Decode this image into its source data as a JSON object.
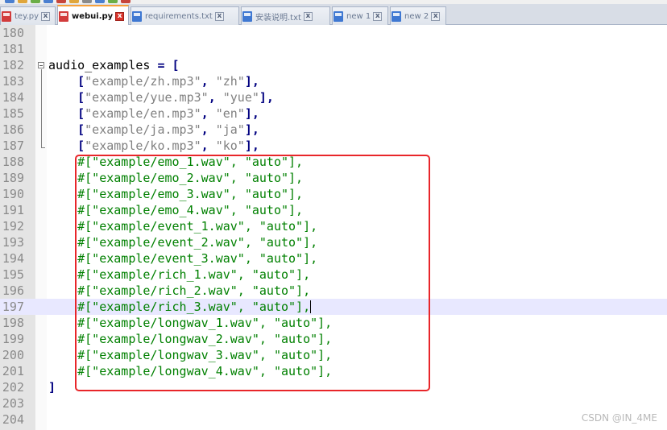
{
  "tabs": [
    {
      "label": "tey.py",
      "state": "unsaved",
      "active": false
    },
    {
      "label": "webui.py",
      "state": "unsaved",
      "active": true
    },
    {
      "label": "requirements.txt",
      "state": "saved",
      "active": false
    },
    {
      "label": "安装说明.txt",
      "state": "saved",
      "active": false
    },
    {
      "label": "new 1",
      "state": "saved",
      "active": false
    },
    {
      "label": "new 2",
      "state": "saved",
      "active": false
    }
  ],
  "tab_close_glyph": "x",
  "editor": {
    "current_line": 197,
    "lines": [
      {
        "num": "180",
        "parts": []
      },
      {
        "num": "181",
        "parts": []
      },
      {
        "num": "182",
        "parts": [
          {
            "t": "plain",
            "v": "audio_examples "
          },
          {
            "t": "kw",
            "v": "= ["
          }
        ]
      },
      {
        "num": "183",
        "parts": [
          {
            "t": "plain",
            "v": "    "
          },
          {
            "t": "kw",
            "v": "["
          },
          {
            "t": "str",
            "v": "\"example/zh.mp3\""
          },
          {
            "t": "kw",
            "v": ", "
          },
          {
            "t": "str",
            "v": "\"zh\""
          },
          {
            "t": "kw",
            "v": "],"
          }
        ]
      },
      {
        "num": "184",
        "parts": [
          {
            "t": "plain",
            "v": "    "
          },
          {
            "t": "kw",
            "v": "["
          },
          {
            "t": "str",
            "v": "\"example/yue.mp3\""
          },
          {
            "t": "kw",
            "v": ", "
          },
          {
            "t": "str",
            "v": "\"yue\""
          },
          {
            "t": "kw",
            "v": "],"
          }
        ]
      },
      {
        "num": "185",
        "parts": [
          {
            "t": "plain",
            "v": "    "
          },
          {
            "t": "kw",
            "v": "["
          },
          {
            "t": "str",
            "v": "\"example/en.mp3\""
          },
          {
            "t": "kw",
            "v": ", "
          },
          {
            "t": "str",
            "v": "\"en\""
          },
          {
            "t": "kw",
            "v": "],"
          }
        ]
      },
      {
        "num": "186",
        "parts": [
          {
            "t": "plain",
            "v": "    "
          },
          {
            "t": "kw",
            "v": "["
          },
          {
            "t": "str",
            "v": "\"example/ja.mp3\""
          },
          {
            "t": "kw",
            "v": ", "
          },
          {
            "t": "str",
            "v": "\"ja\""
          },
          {
            "t": "kw",
            "v": "],"
          }
        ]
      },
      {
        "num": "187",
        "parts": [
          {
            "t": "plain",
            "v": "    "
          },
          {
            "t": "kw",
            "v": "["
          },
          {
            "t": "str",
            "v": "\"example/ko.mp3\""
          },
          {
            "t": "kw",
            "v": ", "
          },
          {
            "t": "str",
            "v": "\"ko\""
          },
          {
            "t": "kw",
            "v": "],"
          }
        ]
      },
      {
        "num": "188",
        "parts": [
          {
            "t": "plain",
            "v": "    "
          },
          {
            "t": "cm",
            "v": "#[\"example/emo_1.wav\", \"auto\"],"
          }
        ]
      },
      {
        "num": "189",
        "parts": [
          {
            "t": "plain",
            "v": "    "
          },
          {
            "t": "cm",
            "v": "#[\"example/emo_2.wav\", \"auto\"],"
          }
        ]
      },
      {
        "num": "190",
        "parts": [
          {
            "t": "plain",
            "v": "    "
          },
          {
            "t": "cm",
            "v": "#[\"example/emo_3.wav\", \"auto\"],"
          }
        ]
      },
      {
        "num": "191",
        "parts": [
          {
            "t": "plain",
            "v": "    "
          },
          {
            "t": "cm",
            "v": "#[\"example/emo_4.wav\", \"auto\"],"
          }
        ]
      },
      {
        "num": "192",
        "parts": [
          {
            "t": "plain",
            "v": "    "
          },
          {
            "t": "cm",
            "v": "#[\"example/event_1.wav\", \"auto\"],"
          }
        ]
      },
      {
        "num": "193",
        "parts": [
          {
            "t": "plain",
            "v": "    "
          },
          {
            "t": "cm",
            "v": "#[\"example/event_2.wav\", \"auto\"],"
          }
        ]
      },
      {
        "num": "194",
        "parts": [
          {
            "t": "plain",
            "v": "    "
          },
          {
            "t": "cm",
            "v": "#[\"example/event_3.wav\", \"auto\"],"
          }
        ]
      },
      {
        "num": "195",
        "parts": [
          {
            "t": "plain",
            "v": "    "
          },
          {
            "t": "cm",
            "v": "#[\"example/rich_1.wav\", \"auto\"],"
          }
        ]
      },
      {
        "num": "196",
        "parts": [
          {
            "t": "plain",
            "v": "    "
          },
          {
            "t": "cm",
            "v": "#[\"example/rich_2.wav\", \"auto\"],"
          }
        ]
      },
      {
        "num": "197",
        "parts": [
          {
            "t": "plain",
            "v": "    "
          },
          {
            "t": "cm",
            "v": "#[\"example/rich_3.wav\", \"auto\"],"
          }
        ]
      },
      {
        "num": "198",
        "parts": [
          {
            "t": "plain",
            "v": "    "
          },
          {
            "t": "cm",
            "v": "#[\"example/longwav_1.wav\", \"auto\"],"
          }
        ]
      },
      {
        "num": "199",
        "parts": [
          {
            "t": "plain",
            "v": "    "
          },
          {
            "t": "cm",
            "v": "#[\"example/longwav_2.wav\", \"auto\"],"
          }
        ]
      },
      {
        "num": "200",
        "parts": [
          {
            "t": "plain",
            "v": "    "
          },
          {
            "t": "cm",
            "v": "#[\"example/longwav_3.wav\", \"auto\"],"
          }
        ]
      },
      {
        "num": "201",
        "parts": [
          {
            "t": "plain",
            "v": "    "
          },
          {
            "t": "cm",
            "v": "#[\"example/longwav_4.wav\", \"auto\"],"
          }
        ]
      },
      {
        "num": "202",
        "parts": [
          {
            "t": "kw",
            "v": "]"
          }
        ]
      },
      {
        "num": "203",
        "parts": []
      },
      {
        "num": "204",
        "parts": []
      }
    ]
  },
  "watermark": "CSDN @IN_4ME",
  "colors": {
    "annotation_box": "#e8262a",
    "keyword": "#000080",
    "string": "#808080",
    "comment": "#008000",
    "current_line_bg": "#e8e8ff",
    "active_tab_accent": "#f8a13a"
  }
}
